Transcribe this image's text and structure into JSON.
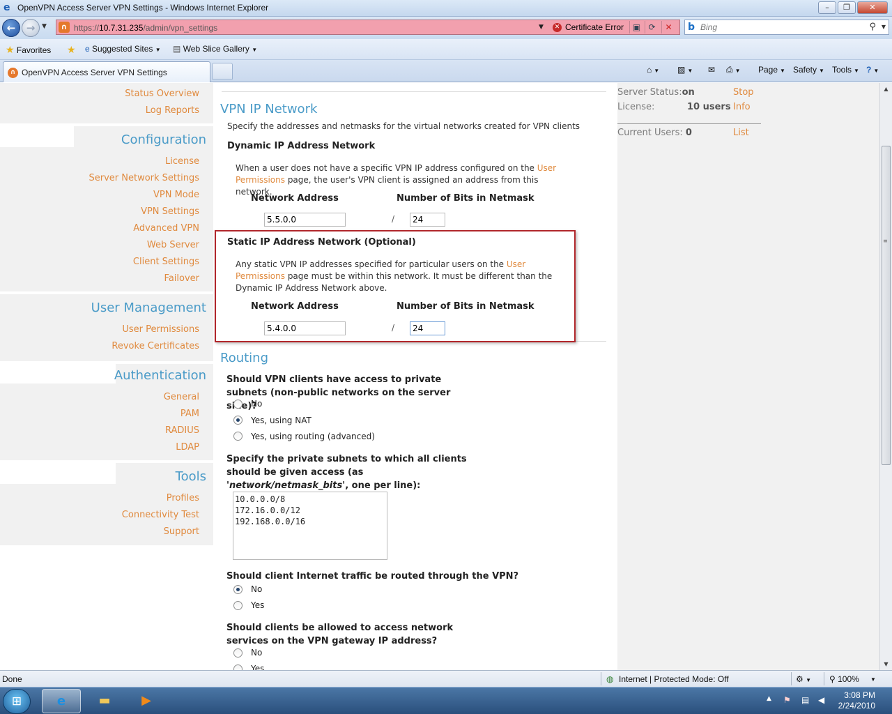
{
  "window": {
    "title": "OpenVPN Access Server VPN Settings - Windows Internet Explorer"
  },
  "address": {
    "url_prefix": "https://",
    "url_host": "10.7.31.235",
    "url_path": "/admin/vpn_settings",
    "certificate_error": "Certificate Error",
    "search_placeholder": "Bing"
  },
  "favorites_bar": {
    "favorites": "Favorites",
    "suggested_sites": "Suggested Sites",
    "web_slice_gallery": "Web Slice Gallery"
  },
  "tabs": {
    "active_label": "OpenVPN Access Server VPN Settings"
  },
  "command_bar": {
    "page": "Page",
    "safety": "Safety",
    "tools": "Tools"
  },
  "sidebar": {
    "top_links": [
      "Status Overview",
      "Log Reports"
    ],
    "configuration": {
      "heading": "Configuration",
      "items": [
        "License",
        "Server Network Settings",
        "VPN Mode",
        "VPN Settings",
        "Advanced VPN",
        "Web Server",
        "Client Settings",
        "Failover"
      ]
    },
    "user_management": {
      "heading": "User Management",
      "items": [
        "User Permissions",
        "Revoke Certificates"
      ]
    },
    "authentication": {
      "heading": "Authentication",
      "items": [
        "General",
        "PAM",
        "RADIUS",
        "LDAP"
      ]
    },
    "tools": {
      "heading": "Tools",
      "items": [
        "Profiles",
        "Connectivity Test",
        "Support"
      ]
    }
  },
  "status_panel": {
    "server_status_label": "Server Status:",
    "server_status_value": "on",
    "stop": "Stop",
    "license_label": "License:",
    "license_value": "10 users",
    "info": "Info",
    "current_users_label": "Current Users:",
    "current_users_value": "0",
    "list": "List"
  },
  "vpn_ip_network": {
    "heading": "VPN IP Network",
    "intro": "Specify the addresses and netmasks for the virtual networks created for VPN clients",
    "dynamic": {
      "heading": "Dynamic IP Address Network",
      "desc_1": "When a user does not have a specific VPN IP address configured on the",
      "desc_link": "User Permissions",
      "desc_2": "page, the user's VPN client is assigned an address from this network.",
      "network_address_label": "Network Address",
      "netmask_label": "Number of Bits in Netmask",
      "network_address": "5.5.0.0",
      "netmask_bits": "24"
    },
    "static": {
      "heading": "Static IP Address Network (Optional)",
      "desc_1": "Any static VPN IP addresses specified for particular users on the",
      "desc_link": "User Permissions",
      "desc_2": "page must be within this network. It must be different than the Dynamic IP Address Network above.",
      "network_address_label": "Network Address",
      "netmask_label": "Number of Bits in Netmask",
      "network_address": "5.4.0.0",
      "netmask_bits": "24"
    },
    "slash": "/"
  },
  "routing": {
    "heading": "Routing",
    "q1": "Should VPN clients have access to private subnets (non-public networks on the server side)?",
    "q1_options": [
      "No",
      "Yes, using NAT",
      "Yes, using routing (advanced)"
    ],
    "q1_selected": "Yes, using NAT",
    "q2_a": "Specify the private subnets to which all clients should be given access (as '",
    "q2_em": "network/netmask_bits",
    "q2_b": "', one per line):",
    "subnets": "10.0.0.0/8\n172.16.0.0/12\n192.168.0.0/16",
    "q3": "Should client Internet traffic be routed through the VPN?",
    "q3_options": [
      "No",
      "Yes"
    ],
    "q3_selected": "No",
    "q4": "Should clients be allowed to access network services on the VPN gateway IP address?",
    "q4_options": [
      "No",
      "Yes"
    ]
  },
  "statusbar": {
    "done": "Done",
    "zone": "Internet | Protected Mode: Off",
    "zoom": "100%"
  },
  "taskbar": {
    "time": "3:08 PM",
    "date": "2/24/2010"
  },
  "colors": {
    "link": "#e08a3e",
    "heading": "#4a9bc8",
    "highlight_border": "#b1262b",
    "address_bar_error": "#f2a0ae"
  }
}
